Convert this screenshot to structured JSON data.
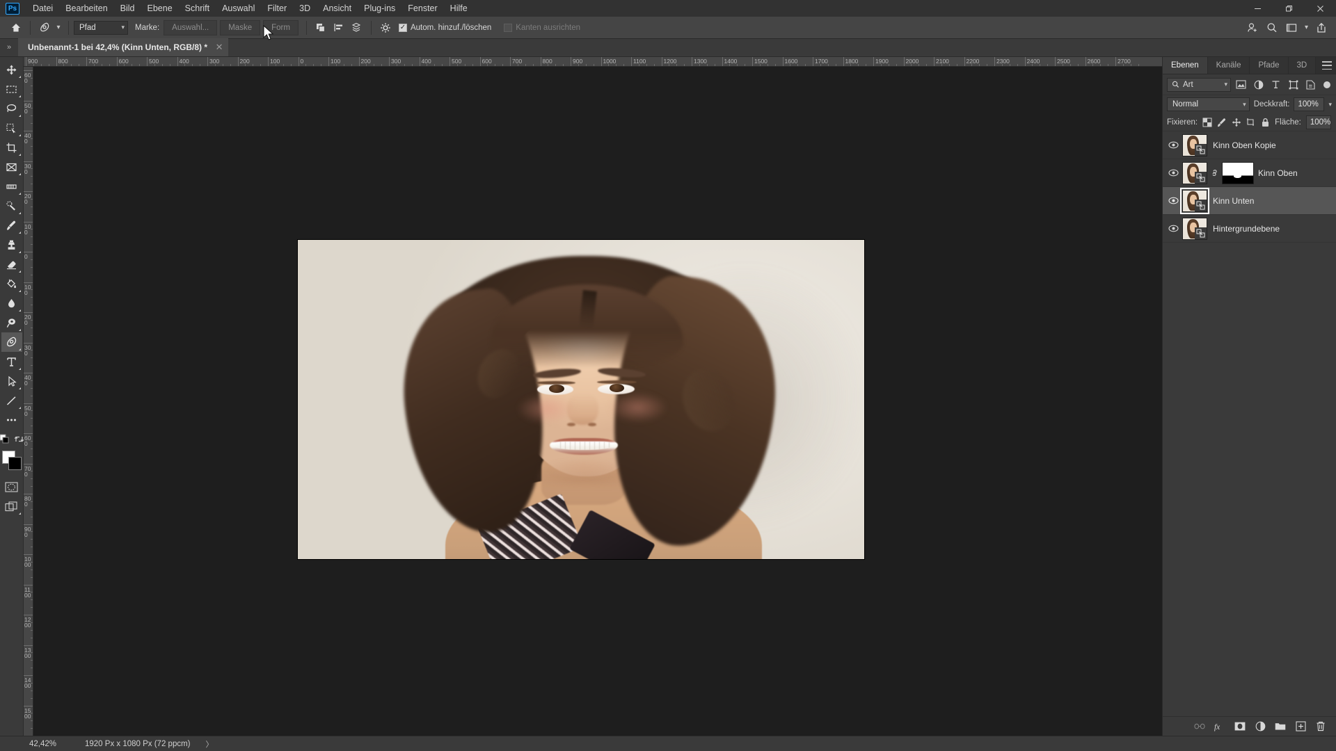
{
  "app": {
    "name": "Adobe Photoshop",
    "logo_text": "Ps"
  },
  "menubar": {
    "items": [
      {
        "label": "Datei"
      },
      {
        "label": "Bearbeiten"
      },
      {
        "label": "Bild"
      },
      {
        "label": "Ebene"
      },
      {
        "label": "Schrift"
      },
      {
        "label": "Auswahl"
      },
      {
        "label": "Filter"
      },
      {
        "label": "3D"
      },
      {
        "label": "Ansicht"
      },
      {
        "label": "Plug-ins"
      },
      {
        "label": "Fenster"
      },
      {
        "label": "Hilfe"
      }
    ],
    "window_controls": {
      "minimize": "—",
      "maximize": "❐",
      "close": "✕"
    }
  },
  "options_bar": {
    "home_icon": "home-icon",
    "tool_icon": "pen-tool-icon",
    "mode_select": {
      "value": "Pfad",
      "caret": "⌄"
    },
    "marke_label": "Marke:",
    "buttons": [
      {
        "label": "Auswahl...",
        "disabled": true
      },
      {
        "label": "Maske",
        "disabled": true
      },
      {
        "label": "Form",
        "disabled": true
      }
    ],
    "path_ops_icon": "path-operations-icon",
    "path_align_icon": "path-alignment-icon",
    "path_arrange_icon": "path-arrangement-icon",
    "gear_icon": "gear-icon",
    "auto_add_delete": {
      "label": "Autom. hinzuf./löschen",
      "checked": true
    },
    "align_edges": {
      "label": "Kanten ausrichten",
      "checked": false,
      "disabled": true
    },
    "right_icons": [
      {
        "name": "add-person-icon"
      },
      {
        "name": "search-icon"
      },
      {
        "name": "workspace-icon"
      },
      {
        "name": "share-icon"
      }
    ]
  },
  "tabbar": {
    "collapse_icon": "chevron-double-right-icon",
    "document_tab": {
      "title": "Unbenannt-1 bei 42,4% (Kinn Unten, RGB/8) *",
      "close": "✕"
    }
  },
  "toolbar": {
    "tools": [
      {
        "name": "move-tool",
        "glyph": "move"
      },
      {
        "name": "rectangular-marquee-tool",
        "glyph": "marquee"
      },
      {
        "name": "lasso-tool",
        "glyph": "lasso"
      },
      {
        "name": "quick-selection-tool",
        "glyph": "quickselect"
      },
      {
        "name": "crop-tool",
        "glyph": "crop"
      },
      {
        "name": "frame-tool",
        "glyph": "frame"
      },
      {
        "name": "eyedropper-tool",
        "glyph": "eyedropper"
      },
      {
        "name": "spot-healing-brush-tool",
        "glyph": "healing"
      },
      {
        "name": "brush-tool",
        "glyph": "brush"
      },
      {
        "name": "clone-stamp-tool",
        "glyph": "stamp"
      },
      {
        "name": "eraser-tool",
        "glyph": "eraser"
      },
      {
        "name": "gradient-tool",
        "glyph": "paintbucket"
      },
      {
        "name": "blur-tool",
        "glyph": "blur"
      },
      {
        "name": "dodge-tool",
        "glyph": "dodge"
      },
      {
        "name": "pen-tool",
        "glyph": "pen",
        "active": true
      },
      {
        "name": "type-tool",
        "glyph": "type"
      },
      {
        "name": "path-selection-tool",
        "glyph": "pathselect"
      },
      {
        "name": "line-tool",
        "glyph": "line"
      },
      {
        "name": "more-tools",
        "glyph": "more"
      }
    ],
    "edit_toolbar_icon": "edit-toolbar-icon",
    "swap_colors_icon": "swap-colors-icon",
    "foreground_color": "#ffffff",
    "background_color": "#000000",
    "quickmask_icon": "quick-mask-icon",
    "screenmode_icon": "screen-mode-icon"
  },
  "rulers": {
    "horizontal_labels": [
      "900",
      "800",
      "700",
      "600",
      "500",
      "400",
      "300",
      "200",
      "100",
      "0",
      "100",
      "200",
      "300",
      "400",
      "500",
      "600",
      "700",
      "800",
      "900",
      "1000",
      "1100",
      "1200",
      "1300",
      "1400",
      "1500",
      "1600",
      "1700",
      "1800",
      "1900",
      "2000",
      "2100",
      "2200",
      "2300",
      "2400",
      "2500",
      "2600",
      "2700"
    ],
    "vertical_labels": [
      "600",
      "500",
      "400",
      "300",
      "200",
      "100",
      "0",
      "100",
      "200",
      "300",
      "400",
      "500",
      "600",
      "700",
      "800",
      "900",
      "1000",
      "1100",
      "1200",
      "1300",
      "1400",
      "1500"
    ],
    "unit": "Px"
  },
  "canvas": {
    "document_title": "Unbenannt-1",
    "zoom": "42,4%",
    "image_description": "Portrait photo of a smiling woman with long brown wavy hair on a light cream background"
  },
  "right_panel": {
    "tabs": [
      {
        "label": "Ebenen",
        "active": true
      },
      {
        "label": "Kanäle",
        "active": false
      },
      {
        "label": "Pfade",
        "active": false
      },
      {
        "label": "3D",
        "active": false
      }
    ],
    "menu_icon": "panel-menu-icon",
    "filter": {
      "search_icon": "search-icon",
      "kind_value": "Art",
      "caret": "⌄",
      "icons": [
        {
          "name": "filter-pixel-icon"
        },
        {
          "name": "filter-adjustment-icon"
        },
        {
          "name": "filter-type-icon"
        },
        {
          "name": "filter-shape-icon"
        },
        {
          "name": "filter-smartobject-icon"
        }
      ],
      "toggle_name": "filter-toggle-switch"
    },
    "blend": {
      "mode_value": "Normal",
      "caret": "⌄",
      "opacity_label": "Deckkraft:",
      "opacity_value": "100%"
    },
    "lock": {
      "label": "Fixieren:",
      "icons": [
        {
          "name": "lock-transparent-pixels-icon"
        },
        {
          "name": "lock-image-pixels-icon"
        },
        {
          "name": "lock-position-icon"
        },
        {
          "name": "lock-artboard-nesting-icon"
        },
        {
          "name": "lock-all-icon"
        }
      ],
      "fill_label": "Fläche:",
      "fill_value": "100%"
    },
    "layers": [
      {
        "name": "Kinn Oben Kopie",
        "visible": true,
        "selected": false,
        "has_mask": false,
        "smart_object": true
      },
      {
        "name": "Kinn Oben",
        "visible": true,
        "selected": false,
        "has_mask": true,
        "linked": true,
        "smart_object": true
      },
      {
        "name": "Kinn Unten",
        "visible": true,
        "selected": true,
        "has_mask": false,
        "smart_object": true
      },
      {
        "name": "Hintergrundebene",
        "visible": true,
        "selected": false,
        "has_mask": false,
        "smart_object": true
      }
    ],
    "bottom_icons": [
      {
        "name": "link-layers-icon",
        "disabled": true
      },
      {
        "name": "layer-style-fx-icon",
        "disabled": false
      },
      {
        "name": "add-layer-mask-icon",
        "disabled": false
      },
      {
        "name": "new-adjustment-layer-icon",
        "disabled": false
      },
      {
        "name": "new-group-icon",
        "disabled": false
      },
      {
        "name": "new-layer-icon",
        "disabled": false
      },
      {
        "name": "delete-layer-icon",
        "disabled": false
      }
    ]
  },
  "statusbar": {
    "zoom_value": "42,42%",
    "doc_size": "1920 Px x 1080 Px (72 ppcm)",
    "caret": "〉"
  }
}
